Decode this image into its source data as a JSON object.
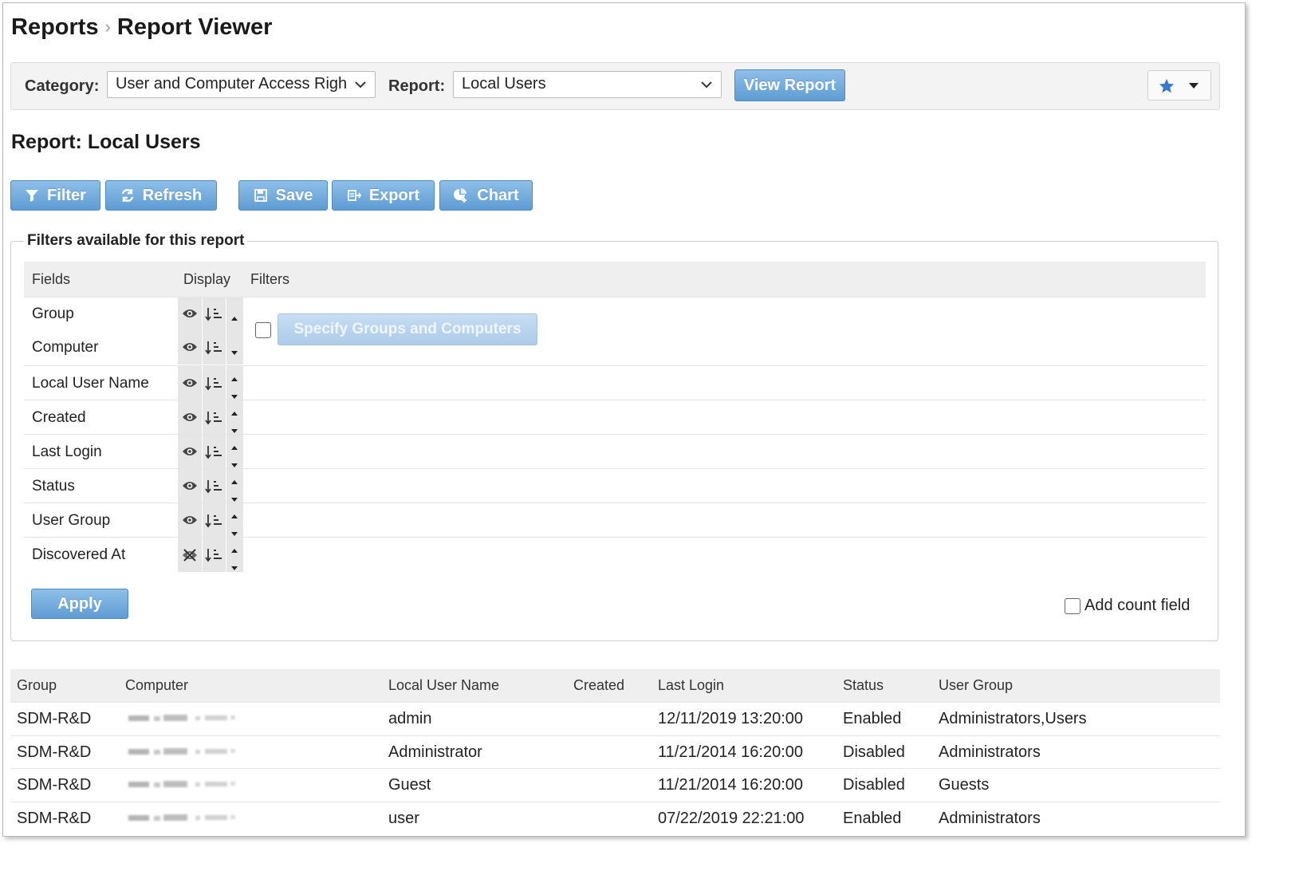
{
  "breadcrumb": {
    "root": "Reports",
    "current": "Report Viewer"
  },
  "toolbar": {
    "category_label": "Category:",
    "category_value": "User and Computer Access Righ",
    "report_label": "Report:",
    "report_value": "Local Users",
    "view_button": "View Report",
    "favorite_icon": "star-icon"
  },
  "report": {
    "title": "Report: Local Users"
  },
  "actions": {
    "filter": "Filter",
    "refresh": "Refresh",
    "save": "Save",
    "export": "Export",
    "chart": "Chart"
  },
  "filters": {
    "legend": "Filters available for this report",
    "headers": {
      "fields": "Fields",
      "display": "Display",
      "filters": "Filters"
    },
    "rows": [
      {
        "name": "Group",
        "visible": true
      },
      {
        "name": "Computer",
        "visible": true
      },
      {
        "name": "Local User Name",
        "visible": true
      },
      {
        "name": "Created",
        "visible": true
      },
      {
        "name": "Last Login",
        "visible": true
      },
      {
        "name": "Status",
        "visible": true
      },
      {
        "name": "User Group",
        "visible": true
      },
      {
        "name": "Discovered At",
        "visible": false
      }
    ],
    "specify_button": "Specify Groups and Computers",
    "apply_button": "Apply",
    "add_count_label": "Add count field"
  },
  "results": {
    "headers": [
      "Group",
      "Computer",
      "Local User Name",
      "Created",
      "Last Login",
      "Status",
      "User Group"
    ],
    "rows": [
      {
        "group": "SDM-R&D",
        "computer": "",
        "user": "admin",
        "created": "",
        "last_login": "12/11/2019 13:20:00",
        "status": "Enabled",
        "user_group": "Administrators,Users"
      },
      {
        "group": "SDM-R&D",
        "computer": "",
        "user": "Administrator",
        "created": "",
        "last_login": "11/21/2014 16:20:00",
        "status": "Disabled",
        "user_group": "Administrators"
      },
      {
        "group": "SDM-R&D",
        "computer": "",
        "user": "Guest",
        "created": "",
        "last_login": "11/21/2014 16:20:00",
        "status": "Disabled",
        "user_group": "Guests"
      },
      {
        "group": "SDM-R&D",
        "computer": "",
        "user": "user",
        "created": "",
        "last_login": "07/22/2019 22:21:00",
        "status": "Enabled",
        "user_group": "Administrators"
      }
    ]
  },
  "colors": {
    "button_blue": "#5e9cd3",
    "star_blue": "#3a78c9"
  }
}
